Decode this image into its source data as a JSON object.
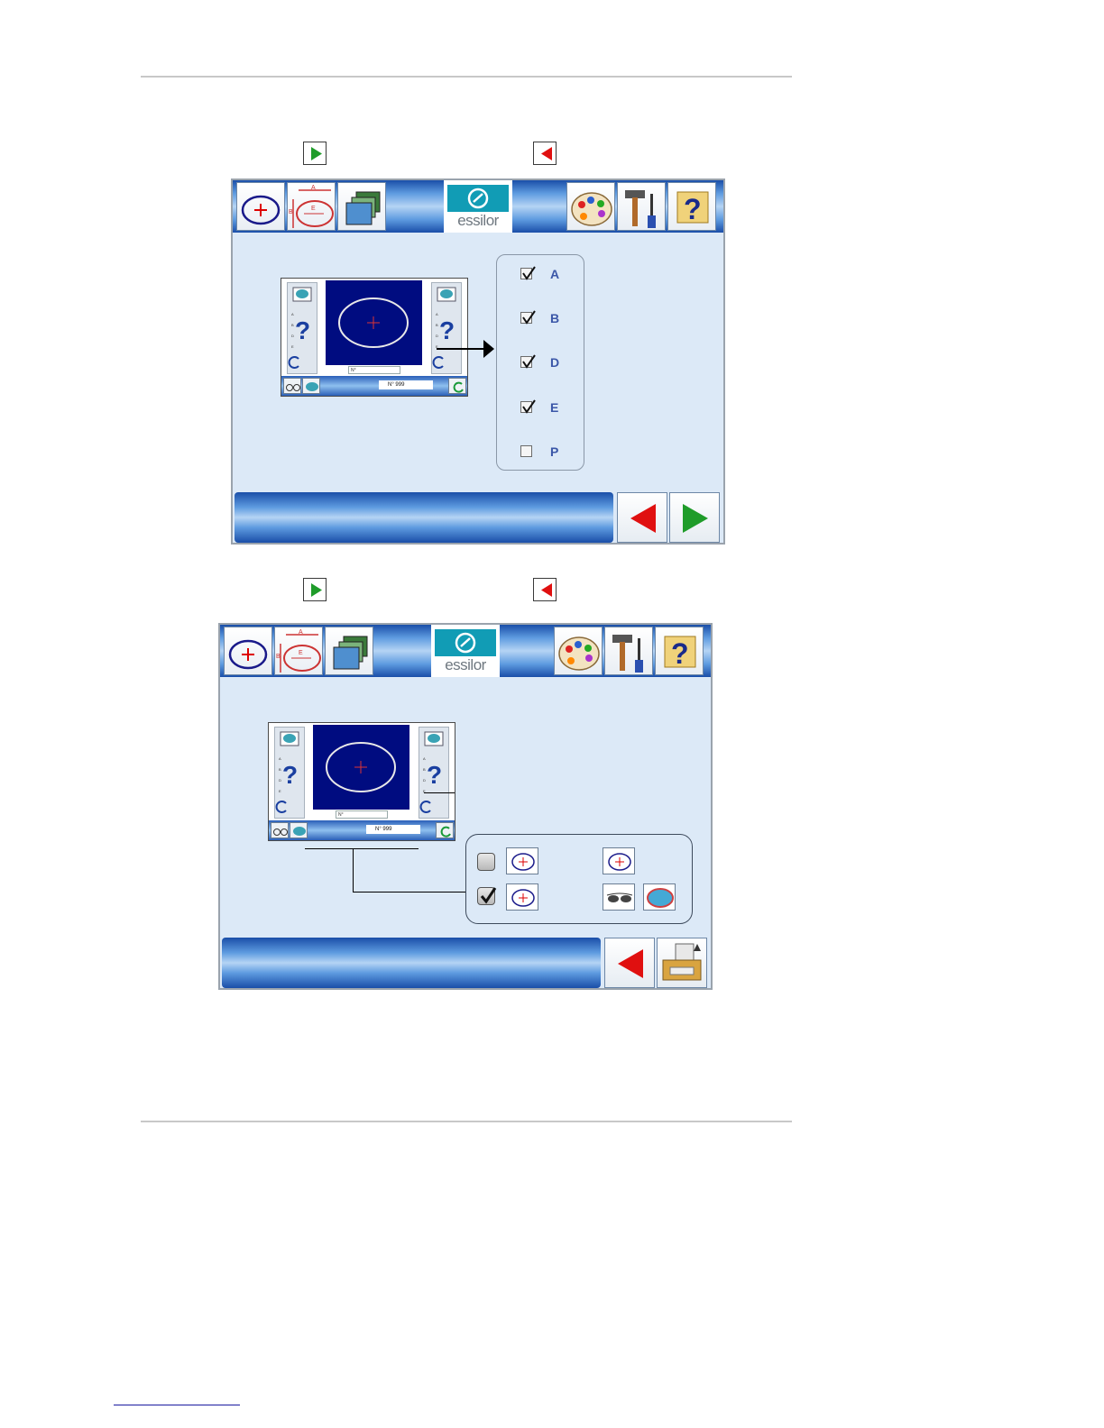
{
  "screen1": {
    "logo_text": "essilor",
    "toolbar_icons": [
      "new-job-icon",
      "shape-dimensions-icon",
      "folders-icon",
      "palette-icon",
      "tools-icon",
      "help-icon"
    ],
    "mini_screen": {
      "field": "N°",
      "job_number": "N° 999"
    },
    "checkbox_options": [
      {
        "label": "A",
        "checked": true
      },
      {
        "label": "B",
        "checked": true
      },
      {
        "label": "D",
        "checked": true
      },
      {
        "label": "E",
        "checked": true
      },
      {
        "label": "P",
        "checked": false
      }
    ],
    "bottom_buttons": [
      "previous-arrow-icon",
      "next-arrow-icon"
    ]
  },
  "screen2": {
    "logo_text": "essilor",
    "toolbar_icons": [
      "new-job-icon",
      "shape-dimensions-icon",
      "folders-icon",
      "palette-icon",
      "tools-icon",
      "help-icon"
    ],
    "mini_screen": {
      "field": "N°",
      "job_number": "N° 999"
    },
    "print_options": [
      {
        "checked": false,
        "icons": [
          "lens-icon",
          "lens-icon"
        ]
      },
      {
        "checked": true,
        "icons": [
          "lens-icon",
          "glasses-icon",
          "colored-lens-icon"
        ]
      }
    ],
    "bottom_buttons": [
      "previous-arrow-icon",
      "print-icon"
    ]
  },
  "colors": {
    "next": "#1f9c2a",
    "previous": "#e01010",
    "screen_bg": "#dce9f7",
    "display": "#000c80"
  }
}
